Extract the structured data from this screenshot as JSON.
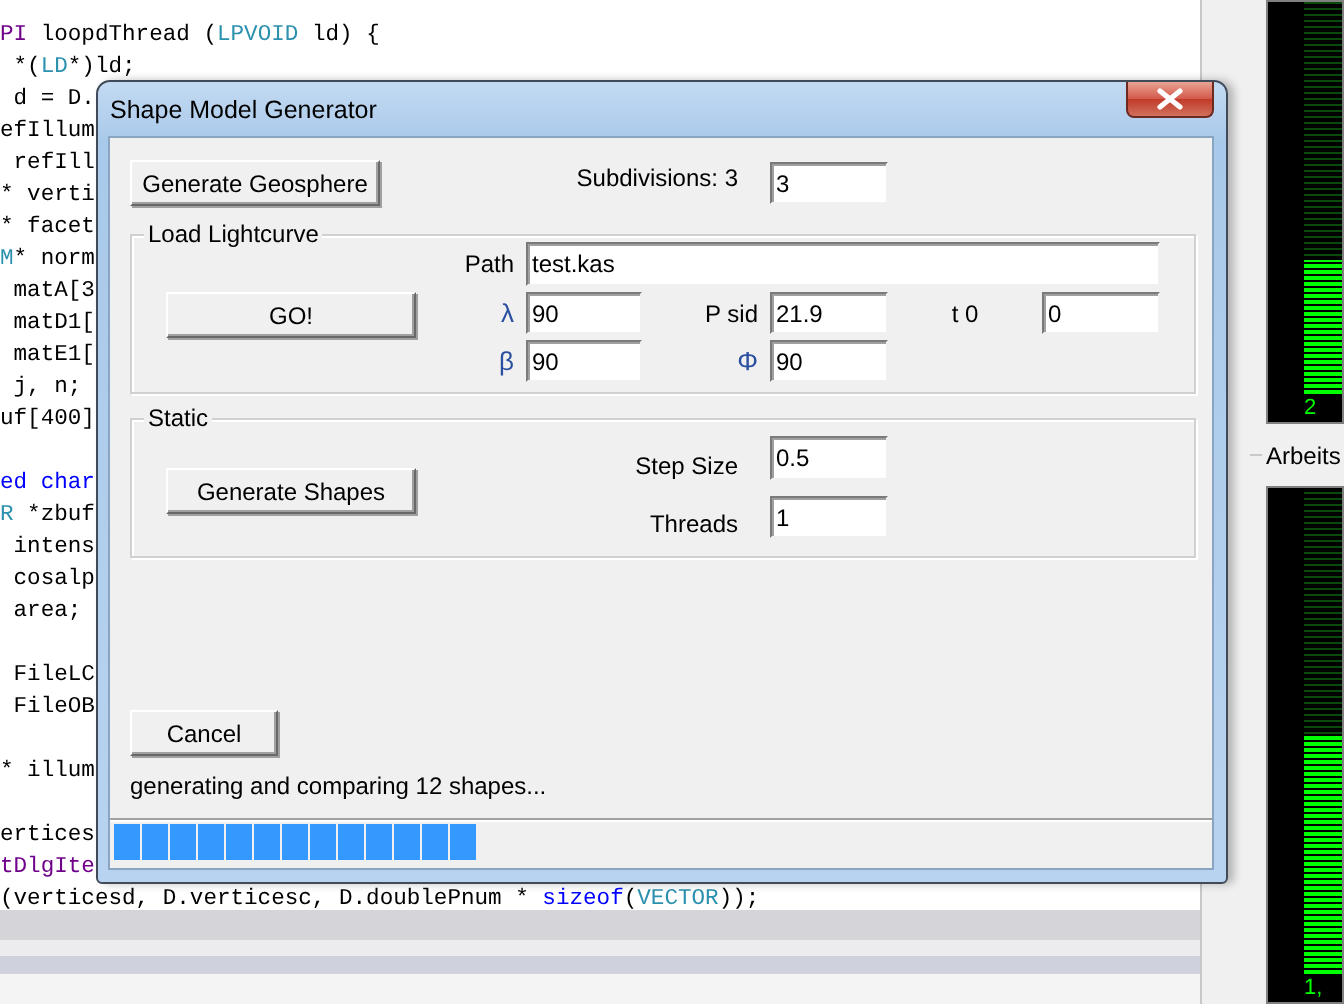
{
  "editor": {
    "lines": [
      {
        "tokens": [
          {
            "kind": "macro",
            "text": "PI"
          },
          {
            "kind": "plain",
            "text": " loopdThread ("
          },
          {
            "kind": "type",
            "text": "LPVOID"
          },
          {
            "kind": "plain",
            "text": " ld) {"
          }
        ]
      },
      {
        "tokens": [
          {
            "kind": "plain",
            "text": " *("
          },
          {
            "kind": "type",
            "text": "LD"
          },
          {
            "kind": "plain",
            "text": "*)ld;"
          }
        ]
      },
      {
        "tokens": [
          {
            "kind": "plain",
            "text": " d = D."
          }
        ]
      },
      {
        "tokens": [
          {
            "kind": "plain",
            "text": "efIllum"
          }
        ]
      },
      {
        "tokens": [
          {
            "kind": "plain",
            "text": " refIll"
          }
        ]
      },
      {
        "tokens": [
          {
            "kind": "plain",
            "text": "* verti"
          }
        ]
      },
      {
        "tokens": [
          {
            "kind": "plain",
            "text": "* facet"
          }
        ]
      },
      {
        "tokens": [
          {
            "kind": "type",
            "text": "M"
          },
          {
            "kind": "plain",
            "text": "* norm"
          }
        ]
      },
      {
        "tokens": [
          {
            "kind": "plain",
            "text": " matA[3"
          }
        ]
      },
      {
        "tokens": [
          {
            "kind": "plain",
            "text": " matD1["
          }
        ]
      },
      {
        "tokens": [
          {
            "kind": "plain",
            "text": " matE1["
          }
        ]
      },
      {
        "tokens": [
          {
            "kind": "plain",
            "text": " j, n;"
          }
        ]
      },
      {
        "tokens": [
          {
            "kind": "plain",
            "text": "uf[400]"
          }
        ]
      },
      {
        "blank_before": true,
        "tokens": [
          {
            "kind": "keyword",
            "text": "ed char"
          }
        ]
      },
      {
        "tokens": [
          {
            "kind": "type",
            "text": "R"
          },
          {
            "kind": "plain",
            "text": " *zbuf"
          }
        ]
      },
      {
        "tokens": [
          {
            "kind": "plain",
            "text": " intens"
          }
        ]
      },
      {
        "tokens": [
          {
            "kind": "plain",
            "text": " cosalp"
          }
        ]
      },
      {
        "tokens": [
          {
            "kind": "plain",
            "text": " area;"
          }
        ]
      },
      {
        "blank_before": true,
        "tokens": [
          {
            "kind": "plain",
            "text": " FileLC"
          }
        ]
      },
      {
        "tokens": [
          {
            "kind": "plain",
            "text": " FileOB"
          }
        ]
      },
      {
        "blank_before": true,
        "tokens": [
          {
            "kind": "plain",
            "text": "* illum"
          }
        ]
      },
      {
        "blank_before": true,
        "tokens": [
          {
            "kind": "plain",
            "text": "ertices"
          }
        ]
      },
      {
        "tokens": [
          {
            "kind": "macro",
            "text": "tDlgIte"
          }
        ]
      },
      {
        "tokens": [
          {
            "kind": "plain",
            "text": "(verticesd, D.verticesc, D.doublePnum * "
          },
          {
            "kind": "keyword",
            "text": "sizeof"
          },
          {
            "kind": "plain",
            "text": "("
          },
          {
            "kind": "type",
            "text": "VECTOR"
          },
          {
            "kind": "plain",
            "text": "));"
          }
        ]
      }
    ]
  },
  "dialog": {
    "title": "Shape Model Generator",
    "generate_geosphere": "Generate Geosphere",
    "subdivisions": {
      "label": "Subdivisions: 3",
      "value": "3"
    },
    "load_lightcurve": {
      "title": "Load Lightcurve",
      "path": {
        "label": "Path",
        "value": "test.kas"
      },
      "button": "GO!",
      "fields": [
        {
          "label": "λ",
          "kind": "symbol",
          "value": "90"
        },
        {
          "label": "P sid",
          "kind": "text",
          "value": "21.9"
        },
        {
          "label": "t 0",
          "kind": "text",
          "value": "0"
        },
        {
          "label": "β",
          "kind": "symbol",
          "value": "90"
        },
        {
          "label": "Φ",
          "kind": "symbol",
          "value": "90"
        }
      ]
    },
    "static": {
      "title": "Static",
      "button": "Generate Shapes",
      "fields": [
        {
          "label": "Step Size",
          "value": "0.5"
        },
        {
          "label": "Threads",
          "value": "1"
        }
      ]
    },
    "cancel": "Cancel",
    "status": "generating and comparing 12 shapes...",
    "progress": {
      "level": 0.333
    }
  },
  "side_panel": {
    "graphs": [
      {
        "reading": "2",
        "level": 0.34
      },
      {
        "label": "Arbeits",
        "reading": "1,",
        "level": 0.49
      }
    ]
  }
}
